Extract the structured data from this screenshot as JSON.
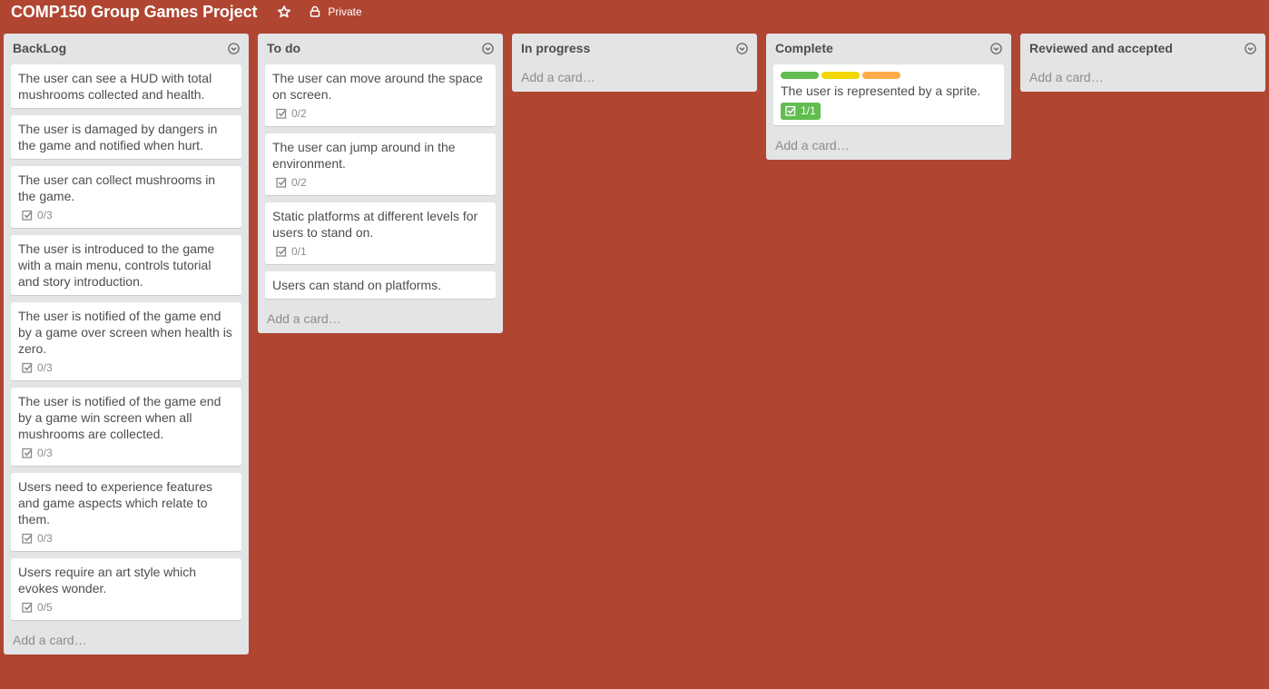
{
  "board": {
    "title": "COMP150 Group Games Project",
    "privacy": "Private",
    "background_color": "#b04632"
  },
  "icons": {
    "star": "star-icon",
    "privacy": "lock-icon",
    "list_menu": "chevron-down-circle-icon",
    "checklist": "checkbox-icon"
  },
  "lists": [
    {
      "title": "BackLog",
      "add_card": "Add a card…",
      "cards": [
        {
          "text": "The user can see a HUD with total mushrooms collected and health."
        },
        {
          "text": "The user is damaged by dangers in the game and notified when hurt."
        },
        {
          "text": "The user can collect mushrooms in the game.",
          "checklist": "0/3"
        },
        {
          "text": "The user is introduced to the game with a main menu, controls tutorial and story introduction."
        },
        {
          "text": "The user is notified of the game end by a game over screen when health is zero.",
          "checklist": "0/3"
        },
        {
          "text": "The user is notified of the game end by a game win screen when all mushrooms are collected.",
          "checklist": "0/3"
        },
        {
          "text": "Users need to experience features and game aspects which relate to them.",
          "checklist": "0/3"
        },
        {
          "text": "Users require an art style which evokes wonder.",
          "checklist": "0/5"
        }
      ]
    },
    {
      "title": "To do",
      "add_card": "Add a card…",
      "cards": [
        {
          "text": "The user can move around the space on screen.",
          "checklist": "0/2"
        },
        {
          "text": "The user can jump around in the environment.",
          "checklist": "0/2"
        },
        {
          "text": "Static platforms at different levels for users to stand on.",
          "checklist": "0/1"
        },
        {
          "text": "Users can stand on platforms."
        }
      ]
    },
    {
      "title": "In progress",
      "add_card": "Add a card…",
      "cards": []
    },
    {
      "title": "Complete",
      "add_card": "Add a card…",
      "cards": [
        {
          "text": "The user is represented by a sprite.",
          "labels": [
            "#61bd4f",
            "#f2d600",
            "#ffab4a"
          ],
          "checklist": "1/1",
          "checklist_complete": true
        }
      ]
    },
    {
      "title": "Reviewed and accepted",
      "add_card": "Add a card…",
      "cards": []
    }
  ]
}
